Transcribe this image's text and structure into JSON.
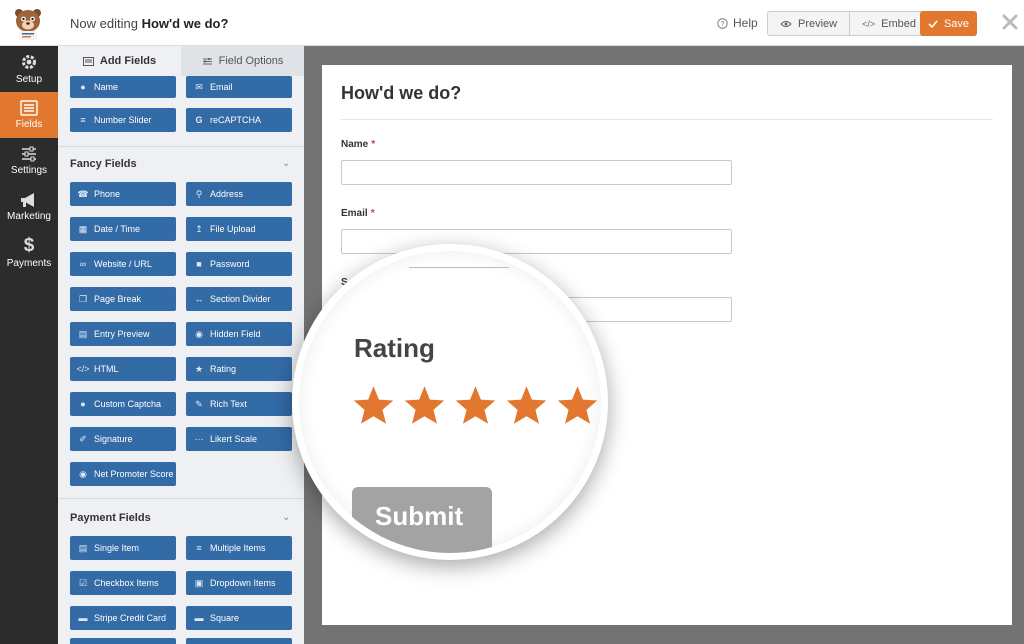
{
  "header": {
    "editing_prefix": "Now editing",
    "form_name": "How'd we do?",
    "help_label": "Help",
    "preview_label": "Preview",
    "embed_label": "Embed",
    "save_label": "Save"
  },
  "nav": {
    "items": [
      {
        "label": "Setup",
        "icon": "gear-icon"
      },
      {
        "label": "Fields",
        "icon": "fields-icon",
        "active": true
      },
      {
        "label": "Settings",
        "icon": "sliders-icon"
      },
      {
        "label": "Marketing",
        "icon": "megaphone-icon"
      },
      {
        "label": "Payments",
        "icon": "dollar-icon"
      }
    ]
  },
  "panel": {
    "tabs": [
      {
        "label": "Add Fields",
        "active": true
      },
      {
        "label": "Field Options",
        "active": false
      }
    ],
    "top_fields": [
      {
        "label": "Name",
        "icon": "user-icon"
      },
      {
        "label": "Email",
        "icon": "envelope-icon"
      },
      {
        "label": "Number Slider",
        "icon": "slider-icon"
      },
      {
        "label": "reCAPTCHA",
        "icon": "google-icon"
      }
    ],
    "fancy": {
      "title": "Fancy Fields",
      "fields": [
        {
          "label": "Phone",
          "icon": "phone-icon"
        },
        {
          "label": "Address",
          "icon": "map-pin-icon"
        },
        {
          "label": "Date / Time",
          "icon": "calendar-icon"
        },
        {
          "label": "File Upload",
          "icon": "upload-icon"
        },
        {
          "label": "Website / URL",
          "icon": "link-icon"
        },
        {
          "label": "Password",
          "icon": "lock-icon"
        },
        {
          "label": "Page Break",
          "icon": "copy-icon"
        },
        {
          "label": "Section Divider",
          "icon": "divider-icon"
        },
        {
          "label": "Entry Preview",
          "icon": "document-icon"
        },
        {
          "label": "Hidden Field",
          "icon": "eye-slash-icon"
        },
        {
          "label": "HTML",
          "icon": "code-icon"
        },
        {
          "label": "Rating",
          "icon": "star-icon"
        },
        {
          "label": "Custom Captcha",
          "icon": "question-icon"
        },
        {
          "label": "Rich Text",
          "icon": "edit-icon"
        },
        {
          "label": "Signature",
          "icon": "pen-icon"
        },
        {
          "label": "Likert Scale",
          "icon": "dots-icon"
        },
        {
          "label": "Net Promoter Score",
          "icon": "gauge-icon"
        }
      ]
    },
    "payment": {
      "title": "Payment Fields",
      "fields": [
        {
          "label": "Single Item",
          "icon": "file-icon"
        },
        {
          "label": "Multiple Items",
          "icon": "list-icon"
        },
        {
          "label": "Checkbox Items",
          "icon": "checkbox-icon"
        },
        {
          "label": "Dropdown Items",
          "icon": "dropdown-icon"
        },
        {
          "label": "Stripe Credit Card",
          "icon": "card-icon"
        },
        {
          "label": "Square",
          "icon": "square-card-icon"
        }
      ]
    }
  },
  "form": {
    "title": "How'd we do?",
    "fields": [
      {
        "label": "Name",
        "required_mark": "*"
      },
      {
        "label": "Email",
        "required_mark": "*"
      },
      {
        "label": "S"
      }
    ]
  },
  "magnifier": {
    "rating_label": "Rating",
    "stars": 5,
    "submit_label": "Submit"
  },
  "colors": {
    "accent": "#e27730",
    "field_button": "#336ba7",
    "nav_bg": "#2c2c2c",
    "star": "#e27730"
  }
}
